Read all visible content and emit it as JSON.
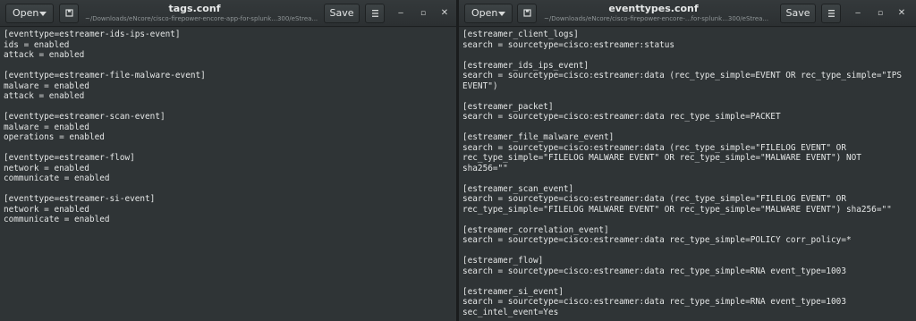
{
  "left_window": {
    "title": "tags.conf",
    "path": "~/Downloads/eNcore/cisco-firepower-encore-app-for-splunk...300/eStrea...",
    "open_label": "Open",
    "save_label": "Save",
    "lines": [
      "[eventtype=estreamer-ids-ips-event]",
      "ids = enabled",
      "attack = enabled",
      "",
      "[eventtype=estreamer-file-malware-event]",
      "malware = enabled",
      "attack = enabled",
      "",
      "[eventtype=estreamer-scan-event]",
      "malware = enabled",
      "operations = enabled",
      "",
      "[eventtype=estreamer-flow]",
      "network = enabled",
      "communicate = enabled",
      "",
      "[eventtype=estreamer-si-event]",
      "network = enabled",
      "communicate = enabled"
    ]
  },
  "right_window": {
    "title": "eventtypes.conf",
    "path": "~/Downloads/eNcore/cisco-firepower-encore-...for-splunk...300/eStrea...",
    "open_label": "Open",
    "save_label": "Save",
    "lines": [
      "[estreamer_client_logs]",
      "search = sourcetype=cisco:estreamer:status",
      "",
      "[estreamer_ids_ips_event]",
      "search = sourcetype=cisco:estreamer:data (rec_type_simple=EVENT OR rec_type_simple=\"IPS",
      "EVENT\")",
      "",
      "[estreamer_packet]",
      "search = sourcetype=cisco:estreamer:data rec_type_simple=PACKET",
      "",
      "[estreamer_file_malware_event]",
      "search = sourcetype=cisco:estreamer:data (rec_type_simple=\"FILELOG EVENT\" OR",
      "rec_type_simple=\"FILELOG MALWARE EVENT\" OR rec_type_simple=\"MALWARE EVENT\") NOT",
      "sha256=\"\"",
      "",
      "[estreamer_scan_event]",
      "search = sourcetype=cisco:estreamer:data (rec_type_simple=\"FILELOG EVENT\" OR",
      "rec_type_simple=\"FILELOG MALWARE EVENT\" OR rec_type_simple=\"MALWARE EVENT\") sha256=\"\"",
      "",
      "[estreamer_correlation_event]",
      "search = sourcetype=cisco:estreamer:data rec_type_simple=POLICY corr_policy=*",
      "",
      "[estreamer_flow]",
      "search = sourcetype=cisco:estreamer:data rec_type_simple=RNA event_type=1003",
      "",
      "[estreamer_si_event]",
      "search = sourcetype=cisco:estreamer:data rec_type_simple=RNA event_type=1003",
      "sec_intel_event=Yes"
    ]
  },
  "window_controls": {
    "minimize": "‒",
    "maximize": "▫",
    "close": "✕"
  }
}
